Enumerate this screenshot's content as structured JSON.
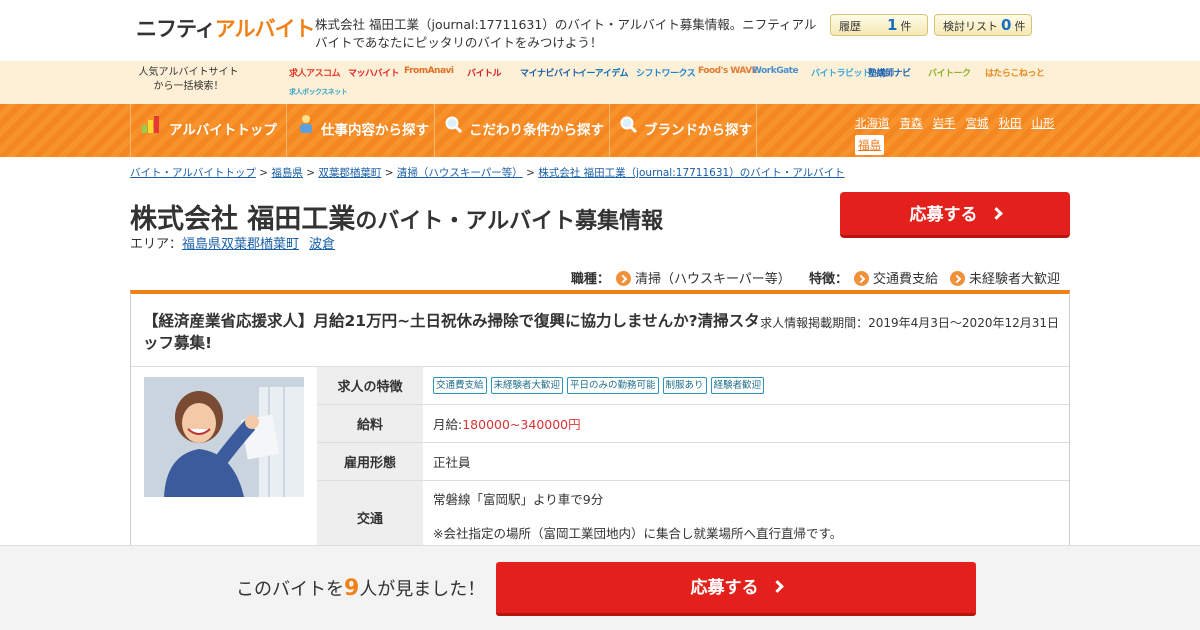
{
  "header": {
    "logo_a": "ニフティ",
    "logo_b": "アルバイト",
    "description": "株式会社 福田工業（journal:17711631）のバイト・アルバイト募集情報。ニフティアルバイトであなたにピッタリのバイトをみつけよう！",
    "history_label": "履歴",
    "history_count": "1",
    "history_unit": "件",
    "consider_label": "検討リスト",
    "consider_count": "0",
    "consider_unit": "件"
  },
  "sites": {
    "label": "人気アルバイトサイトから一括検索！",
    "items": [
      {
        "name": "求人アスコム",
        "color": "#e53b2f"
      },
      {
        "name": "マッハバイト",
        "color": "#e8242b"
      },
      {
        "name": "FromAnavi",
        "color": "#e06f25"
      },
      {
        "name": "バイトル",
        "color": "#d81f26"
      },
      {
        "name": "マイナビバイト",
        "color": "#1d5ea8"
      },
      {
        "name": "イーアイデム",
        "color": "#0e6fb3"
      },
      {
        "name": "シフトワークス",
        "color": "#1f84d0"
      },
      {
        "name": "Food's WAVE",
        "color": "#e07b35"
      },
      {
        "name": "WorkGate",
        "color": "#4a90d0"
      },
      {
        "name": "バイトラビット",
        "color": "#38a8d8"
      },
      {
        "name": "塾講師ナビ",
        "color": "#1d62b0"
      },
      {
        "name": "バイトーク",
        "color": "#8cb22a"
      },
      {
        "name": "はたらこねっと",
        "color": "#e48a1d"
      },
      {
        "name": "求人ボックスネット",
        "color": "#3aa3c9"
      }
    ]
  },
  "nav": {
    "items": [
      "アルバイトトップ",
      "仕事内容から探す",
      "こだわり条件から探す",
      "ブランドから探す"
    ],
    "prefectures": [
      "北海道",
      "青森",
      "岩手",
      "宮城",
      "秋田",
      "山形",
      "福島"
    ]
  },
  "breadcrumb": [
    "バイト・アルバイトトップ",
    "福島県",
    "双葉郡楢葉町",
    "清掃（ハウスキーパー等）",
    "株式会社 福田工業（journal:17711631）のバイト・アルバイト"
  ],
  "page": {
    "title_main": "株式会社 福田工業",
    "title_suffix": "のバイト・アルバイト募集情報",
    "area_label": "エリア：",
    "area_pref_city": "福島県双葉郡楢葉町",
    "area_town": "波倉",
    "apply_label": "応募する"
  },
  "tags": {
    "job_key": "職種：",
    "job_value": "清掃（ハウスキーパー等）",
    "feature_key": "特徴：",
    "features": [
      "交通費支給",
      "未経験者大歓迎"
    ]
  },
  "job": {
    "headline": "【経済産業省応援求人】月給21万円~土日祝休み掃除で復興に協力しませんか?清掃スタッフ募集!",
    "period": "求人情報掲載期間：2019年4月3日～2020年12月31日",
    "rows": {
      "features_label": "求人の特徴",
      "features": [
        "交通費支給",
        "未経験者大歓迎",
        "平日のみの勤務可能",
        "制服あり",
        "経験者歓迎"
      ],
      "salary_label": "給料",
      "salary_prefix": "月給:",
      "salary_value": "180000~340000円",
      "employment_label": "雇用形態",
      "employment_value": "正社員",
      "access_label": "交通",
      "access_line1": "常磐線「富岡駅」より車で9分",
      "access_line2": "※会社指定の場所（富岡工業団地内）に集合し就業場所へ直行直帰です。"
    }
  },
  "footer": {
    "seen_prefix": "このバイトを",
    "seen_count": "9",
    "seen_suffix": "人が見ました！",
    "apply_label": "応募する"
  }
}
